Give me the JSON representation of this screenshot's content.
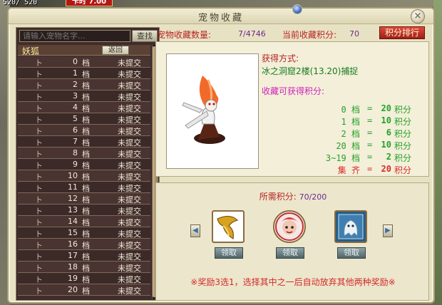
{
  "hud": {
    "hp": "520/ 520",
    "timer": "卡时 7.00"
  },
  "window": {
    "title": "宠物收藏",
    "close_label": "×"
  },
  "search": {
    "placeholder": "请输入宠物名字...",
    "button_label": "查找"
  },
  "list": {
    "pet_name": "妖狐",
    "back_label": "返回",
    "tick": "ト",
    "unit": "档",
    "status": "未提交",
    "grades": [
      "0",
      "1",
      "2",
      "3",
      "4",
      "5",
      "6",
      "7",
      "8",
      "9",
      "10",
      "11",
      "12",
      "13",
      "14",
      "15",
      "16",
      "17",
      "18",
      "19",
      "20"
    ]
  },
  "stats": {
    "count_label": "宠物收藏数量:",
    "count_value": "7/4746",
    "score_label": "当前收藏积分:",
    "score_value": "70",
    "rank_button": "积分排行"
  },
  "info": {
    "obtain_label": "获得方式:",
    "obtain_value": "冰之洞窟2楼(13.20)捕捉",
    "score_label": "收藏可获得积分:",
    "score_rows": [
      {
        "grade": "0 档",
        "value": "20",
        "unit": "积分"
      },
      {
        "grade": "1 档",
        "value": "10",
        "unit": "积分"
      },
      {
        "grade": "2 档",
        "value": "6",
        "unit": "积分"
      },
      {
        "grade": "20 档",
        "value": "10",
        "unit": "积分"
      },
      {
        "grade": "3~19 档",
        "value": "2",
        "unit": "积分"
      },
      {
        "grade": "集 齐",
        "value": "20",
        "unit": "积分"
      }
    ],
    "equals": "="
  },
  "reward": {
    "required_label": "所需积分:",
    "required_value": "70/200",
    "claim_label": "领取",
    "items": [
      {
        "icon": "horn-cape-icon"
      },
      {
        "icon": "pet-portrait-icon"
      },
      {
        "icon": "ghost-card-icon"
      }
    ],
    "note": "※奖励3选1，选择其中之一后自动放弃其他两种奖励※",
    "prev_label": "◀",
    "next_label": "▶"
  },
  "colors": {
    "panel_bg": "#e8e2c4",
    "list_bg": "#3f2c2b",
    "accent_red": "#b72424",
    "accent_green": "#24a12b",
    "accent_purple": "#6b2a8a"
  }
}
